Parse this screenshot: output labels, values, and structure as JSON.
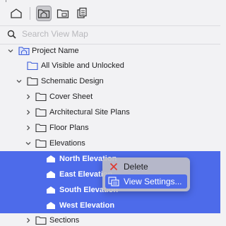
{
  "toolbar": {
    "buttons": [
      {
        "name": "project-map-icon"
      },
      {
        "name": "view-map-icon",
        "active": true
      },
      {
        "name": "layout-book-icon"
      },
      {
        "name": "publisher-sets-icon"
      }
    ]
  },
  "search": {
    "placeholder": "Search View Map"
  },
  "tree": {
    "project": "Project Name",
    "all_visible": "All Visible and Unlocked",
    "schematic": "Schematic Design",
    "cover_sheet": "Cover Sheet",
    "site_plans": "Architectural Site Plans",
    "floor_plans": "Floor Plans",
    "elevations": "Elevations",
    "north": "North Elevation",
    "east": "East Elevation",
    "south": "South Elevation",
    "west": "West Elevation",
    "sections": "Sections"
  },
  "context_menu": {
    "delete": "Delete",
    "view_settings": "View Settings..."
  },
  "colors": {
    "selection": "#4d6bea",
    "delete_x": "#e0362c"
  }
}
